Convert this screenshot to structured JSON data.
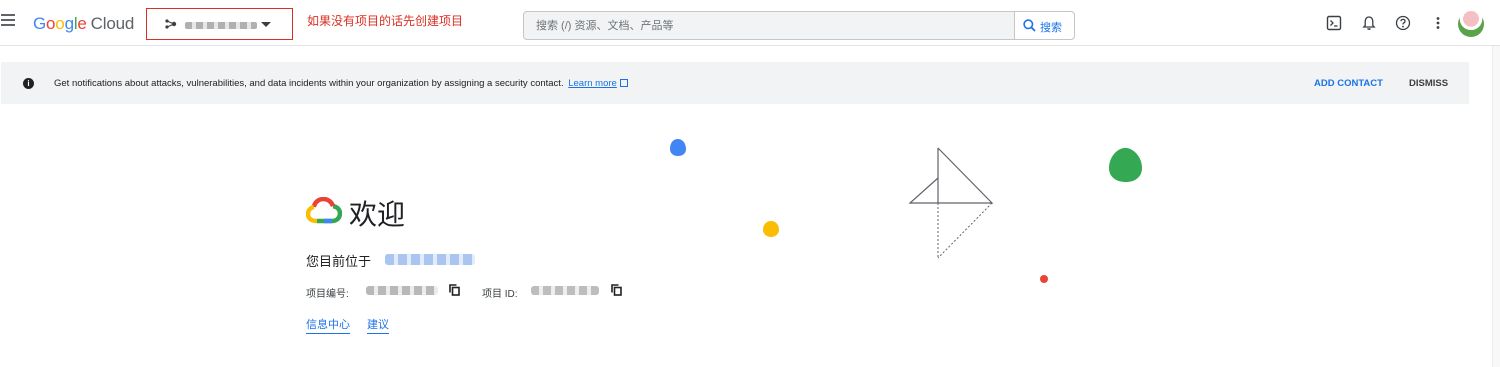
{
  "header": {
    "logo_google": [
      "G",
      "o",
      "o",
      "g",
      "l",
      "e"
    ],
    "logo_cloud": "Cloud",
    "annotation": "如果没有项目的话先创建项目",
    "search_placeholder": "搜索 (/) 资源、文档、产品等",
    "search_button": "搜索"
  },
  "banner": {
    "message": "Get notifications about attacks, vulnerabilities, and data incidents within your organization by assigning a security contact.",
    "learn_more": "Learn more",
    "add_contact": "ADD CONTACT",
    "dismiss": "DISMISS"
  },
  "welcome": {
    "title": "欢迎",
    "current_label": "您目前位于",
    "project_number_label": "项目编号:",
    "project_id_label": "项目 ID:",
    "links": [
      "信息中心",
      "建议"
    ]
  },
  "colors": {
    "accent": "#1a73e8",
    "annotation_red": "#d93025",
    "google_blue": "#4285f4",
    "google_red": "#ea4335",
    "google_yellow": "#fbbc04",
    "google_green": "#34a853"
  },
  "icons": [
    "menu-icon",
    "project-icon",
    "caret-down-icon",
    "search-icon",
    "cloud-shell-icon",
    "bell-icon",
    "help-icon",
    "more-vert-icon",
    "info-icon",
    "external-link-icon",
    "copy-icon",
    "google-cloud-logo-icon"
  ]
}
